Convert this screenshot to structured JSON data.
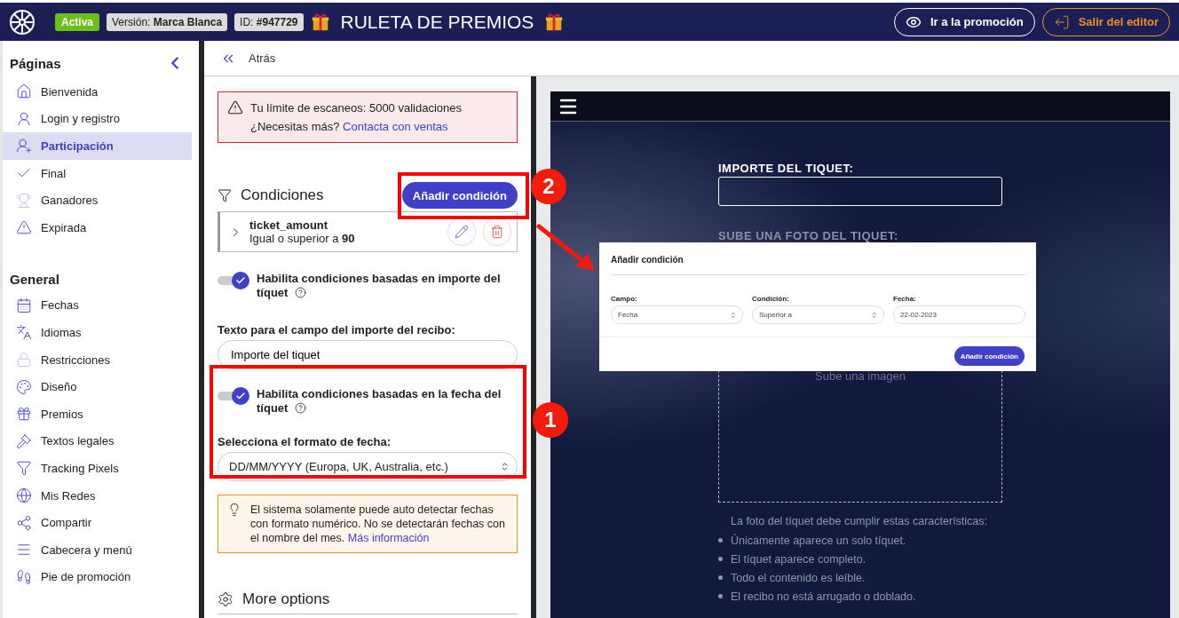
{
  "header": {
    "status": "Activa",
    "version_label": "Versión:",
    "version_value": "Marca Blanca",
    "id_label": "ID:",
    "id_value": "#947729",
    "title": "RULETA DE PREMIOS",
    "buttons": [
      {
        "label": "Ir a la promoción",
        "kind": "outline"
      },
      {
        "label": "Salir del editor",
        "kind": "exit"
      }
    ]
  },
  "sidebar": {
    "sections": [
      {
        "title": "Páginas",
        "items": [
          {
            "label": "Bienvenida",
            "selected": false
          },
          {
            "label": "Login y registro",
            "selected": false
          },
          {
            "label": "Participación",
            "selected": true
          },
          {
            "label": "Final",
            "selected": false
          },
          {
            "label": "Ganadores",
            "selected": false
          },
          {
            "label": "Expirada",
            "selected": false
          }
        ]
      },
      {
        "title": "General",
        "items": [
          {
            "label": "Fechas",
            "selected": false
          },
          {
            "label": "Idiomas",
            "selected": false
          },
          {
            "label": "Restricciones",
            "selected": false
          },
          {
            "label": "Diseño",
            "selected": false
          },
          {
            "label": "Premios",
            "selected": false
          },
          {
            "label": "Textos legales",
            "selected": false
          },
          {
            "label": "Tracking Pixels",
            "selected": false
          },
          {
            "label": "Mis Redes",
            "selected": false
          },
          {
            "label": "Compartir",
            "selected": false
          },
          {
            "label": "Cabecera y menú",
            "selected": false
          },
          {
            "label": "Pie de promoción",
            "selected": false
          }
        ]
      }
    ]
  },
  "back_label": "Atrás",
  "panel": {
    "alert": {
      "line1": "Tu límite de escaneos: 5000 validaciones",
      "line2": "¿Necesitas más?",
      "link": "Contacta con ventas"
    },
    "conditions": {
      "title": "Condiciones",
      "add_button": "Añadir condición",
      "items": [
        {
          "name": "ticket_amount",
          "rule": "Igual o superior a  **90**"
        }
      ]
    },
    "settings": [
      {
        "kind": "toggle",
        "label": "Habilita condiciones basadas en importe del tíquet",
        "on": true
      },
      {
        "kind": "text",
        "label": "Texto para el campo del importe del recibo:",
        "value": "Importe del tiquet"
      },
      {
        "kind": "toggle",
        "label": "Habilita condiciones basadas en la fecha del tíquet",
        "on": true
      },
      {
        "kind": "select",
        "label": "Selecciona el formato de fecha:",
        "value": "DD/MM/YYYY (Europa, UK, Australia, etc.)"
      },
      {
        "kind": "tip",
        "text": "El sistema solamente puede auto detectar fechas con formato numérico. No se detectarán fechas con el nombre del mes.",
        "link": "Más información"
      }
    ],
    "more_options": "More options"
  },
  "preview": {
    "amount_label": "IMPORTE DEL TIQUET:",
    "upload_label": "SUBE UNA FOTO DEL TIQUET:",
    "upload_hint": "Sube una imagen",
    "requirements_title": "La foto del tíquet debe cumplir estas características:",
    "requirements": [
      "Únicamente aparece un solo tíquet.",
      "El tíquet aparece completo.",
      "Todo el contenido es leíble.",
      "El recibo no está arrugado o doblado."
    ],
    "modal": {
      "title": "Añadir condición",
      "fields": [
        {
          "label": "Campo:",
          "value": "Fecha",
          "kind": "select"
        },
        {
          "label": "Condición:",
          "value": "Superior a",
          "kind": "select"
        },
        {
          "label": "Fecha:",
          "value": "22-02-2023",
          "kind": "input"
        }
      ],
      "button": "Añadir condición"
    }
  },
  "annotations": [
    {
      "number": "2"
    },
    {
      "number": "1"
    }
  ]
}
